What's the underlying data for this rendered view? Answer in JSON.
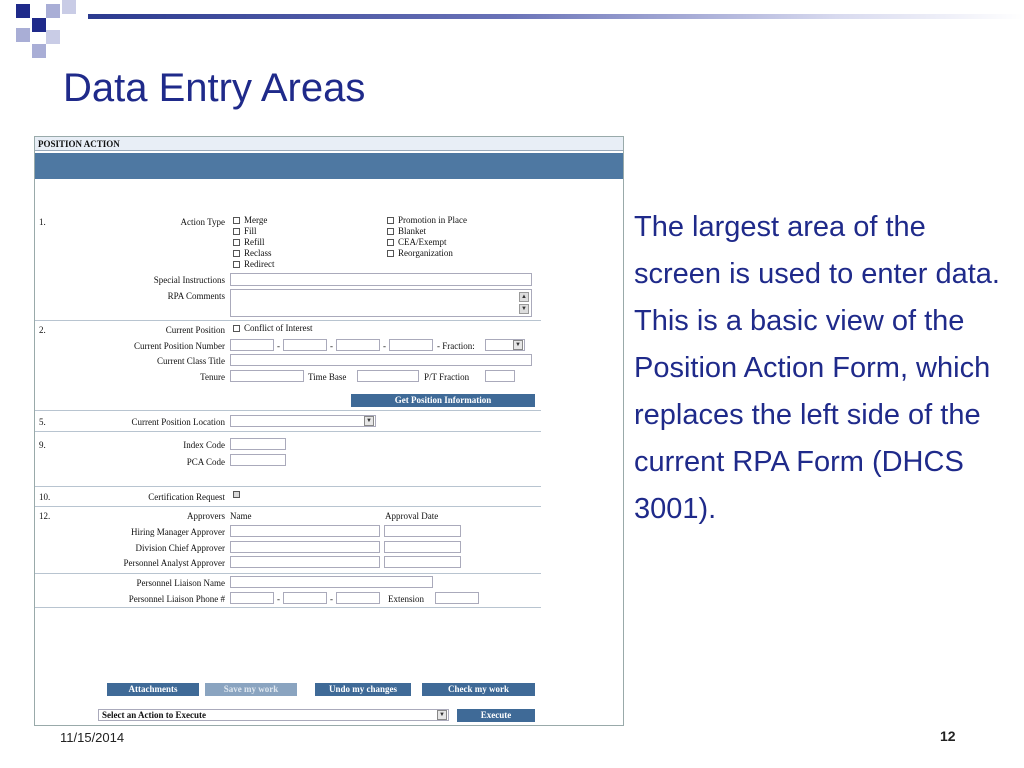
{
  "slide": {
    "title": "Data Entry Areas",
    "body": "The largest area of the screen is used to enter data.  This is a basic view of the Position Action Form, which replaces the left side of the current RPA Form (DHCS 3001).",
    "footer_date": "11/15/2014",
    "page_number": "12"
  },
  "form": {
    "header": "POSITION ACTION",
    "sections": {
      "s1": "1.",
      "s2": "2.",
      "s5": "5.",
      "s9": "9.",
      "s10": "10.",
      "s12": "12."
    },
    "action_type": {
      "label": "Action Type",
      "options": [
        "Merge",
        "Fill",
        "Refill",
        "Reclass",
        "Redirect",
        "Promotion in Place",
        "Blanket",
        "CEA/Exempt",
        "Reorganization"
      ]
    },
    "special_instructions_label": "Special Instructions",
    "rpa_comments_label": "RPA Comments",
    "current_position_label": "Current Position",
    "conflict_of_interest": "Conflict of Interest",
    "current_position_number_label": "Current Position Number",
    "dash": "-",
    "fraction_label": "- Fraction:",
    "current_class_title_label": "Current Class Title",
    "tenure_label": "Tenure",
    "time_base_label": "Time Base",
    "pt_fraction_label": "P/T Fraction",
    "get_position_button": "Get Position Information",
    "current_position_location_label": "Current Position Location",
    "index_code_label": "Index Code",
    "pca_code_label": "PCA Code",
    "certification_request_label": "Certification Request",
    "approvers": {
      "label": "Approvers",
      "name_header": "Name",
      "date_header": "Approval Date",
      "rows": [
        "Hiring Manager Approver",
        "Division Chief Approver",
        "Personnel Analyst Approver"
      ]
    },
    "liaison_name_label": "Personnel Liaison Name",
    "liaison_phone_label": "Personnel Liaison Phone #",
    "extension_label": "Extension",
    "buttons": {
      "attachments": "Attachments",
      "save": "Save my work",
      "undo": "Undo my changes",
      "check": "Check my work",
      "execute": "Execute"
    },
    "action_select": "Select an Action to Execute"
  },
  "colors": {
    "title": "#1f2a8a",
    "band": "#4e78a2",
    "button": "#3f6a97"
  }
}
